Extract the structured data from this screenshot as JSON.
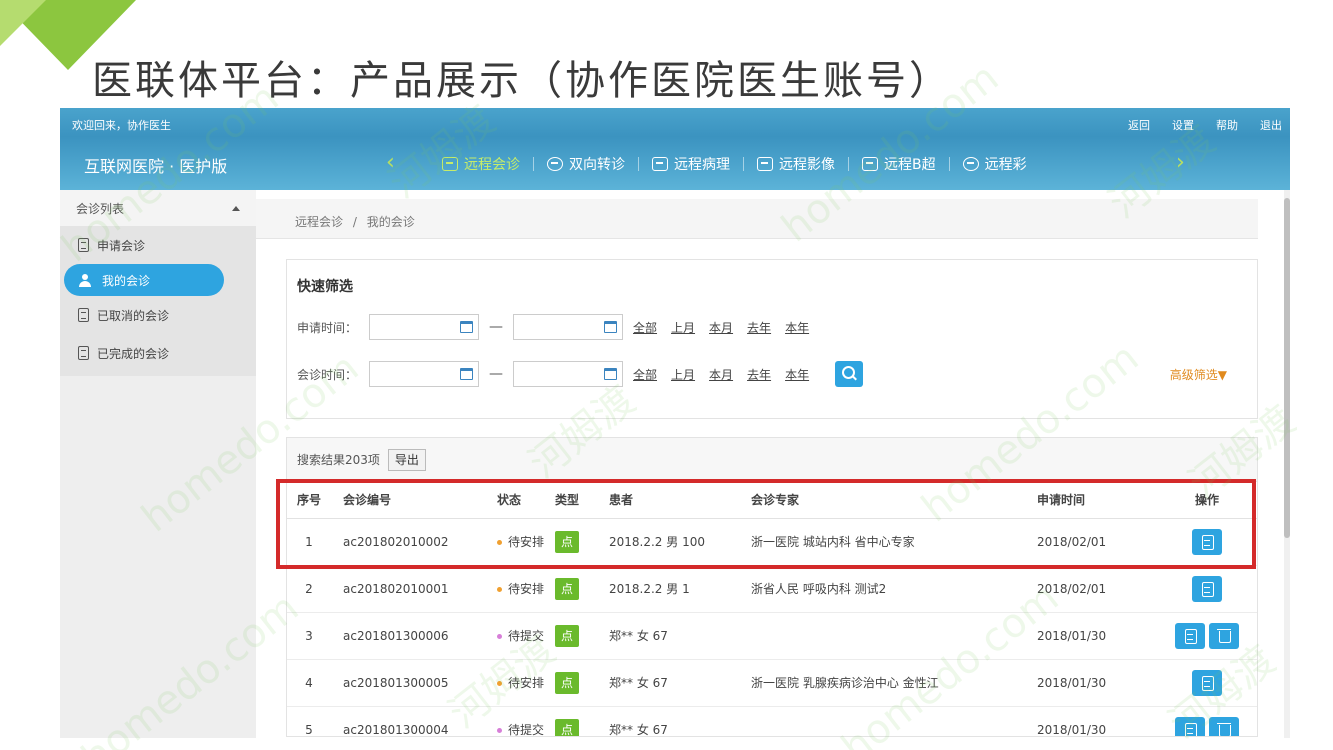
{
  "slide": {
    "title": "医联体平台：产品展示（协作医院医生账号）"
  },
  "header": {
    "welcome": "欢迎回来，协作医生",
    "links": [
      "返回",
      "设置",
      "帮助",
      "退出"
    ],
    "brand": "互联网医院 · 医护版",
    "nav_prev": "‹",
    "nav_next": "›",
    "nav": [
      {
        "label": "远程会诊",
        "icon": "monitor-icon",
        "active": true
      },
      {
        "label": "双向转诊",
        "icon": "transfer-icon"
      },
      {
        "label": "远程病理",
        "icon": "medkit-icon"
      },
      {
        "label": "远程影像",
        "icon": "image-icon"
      },
      {
        "label": "远程B超",
        "icon": "medkit-icon"
      },
      {
        "label": "远程彩",
        "icon": "transfer-icon"
      }
    ]
  },
  "sidebar": {
    "section": "会诊列表",
    "items": [
      {
        "label": "申请会诊",
        "icon": "clipboard-icon"
      },
      {
        "label": "我的会诊",
        "icon": "users-icon",
        "active": true
      },
      {
        "label": "已取消的会诊",
        "icon": "clipboard-icon"
      },
      {
        "label": "已完成的会诊",
        "icon": "clipboard-icon"
      }
    ]
  },
  "breadcrumb": {
    "items": [
      "远程会诊",
      "我的会诊"
    ],
    "separator": "/"
  },
  "filter": {
    "title": "快速筛选",
    "apply_time_label": "申请时间：",
    "consult_time_label": "会诊时间：",
    "quick_links": [
      "全部",
      "上月",
      "本月",
      "去年",
      "本年"
    ],
    "dash": "—",
    "advanced": "高级筛选▼"
  },
  "results": {
    "count_text": "搜索结果203项",
    "export": "导出",
    "columns": [
      "序号",
      "会诊编号",
      "状态",
      "类型",
      "患者",
      "会诊专家",
      "申请时间",
      "操作"
    ],
    "rows": [
      {
        "idx": "1",
        "code": "ac201802010002",
        "status": "待安排",
        "status_color": "#f0a030",
        "type": "点",
        "patient": "2018.2.2 男 100",
        "expert": "浙一医院 城站内科 省中心专家",
        "date": "2018/02/01",
        "ops": [
          "clip"
        ]
      },
      {
        "idx": "2",
        "code": "ac201802010001",
        "status": "待安排",
        "status_color": "#f0a030",
        "type": "点",
        "patient": "2018.2.2 男 1",
        "expert": "浙省人民 呼吸内科 测试2",
        "date": "2018/02/01",
        "ops": [
          "clip"
        ]
      },
      {
        "idx": "3",
        "code": "ac201801300006",
        "status": "待提交",
        "status_color": "#d77fd8",
        "type": "点",
        "patient": "郑** 女 67",
        "expert": "",
        "date": "2018/01/30",
        "ops": [
          "clip",
          "trash"
        ]
      },
      {
        "idx": "4",
        "code": "ac201801300005",
        "status": "待安排",
        "status_color": "#f0a030",
        "type": "点",
        "patient": "郑** 女 67",
        "expert": "浙一医院 乳腺疾病诊治中心 金性江",
        "date": "2018/01/30",
        "ops": [
          "clip"
        ]
      },
      {
        "idx": "5",
        "code": "ac201801300004",
        "status": "待提交",
        "status_color": "#d77fd8",
        "type": "点",
        "patient": "郑** 女 67",
        "expert": "",
        "date": "2018/01/30",
        "ops": [
          "clip",
          "trash"
        ]
      }
    ]
  },
  "watermark": [
    "homedo.com",
    "河姆渡"
  ],
  "colors": {
    "accent": "#2ea4e0",
    "nav_active": "#c6ec6a",
    "highlight": "#d42a2a",
    "type_badge": "#6aba2c",
    "advanced_link": "#e08a1e"
  }
}
